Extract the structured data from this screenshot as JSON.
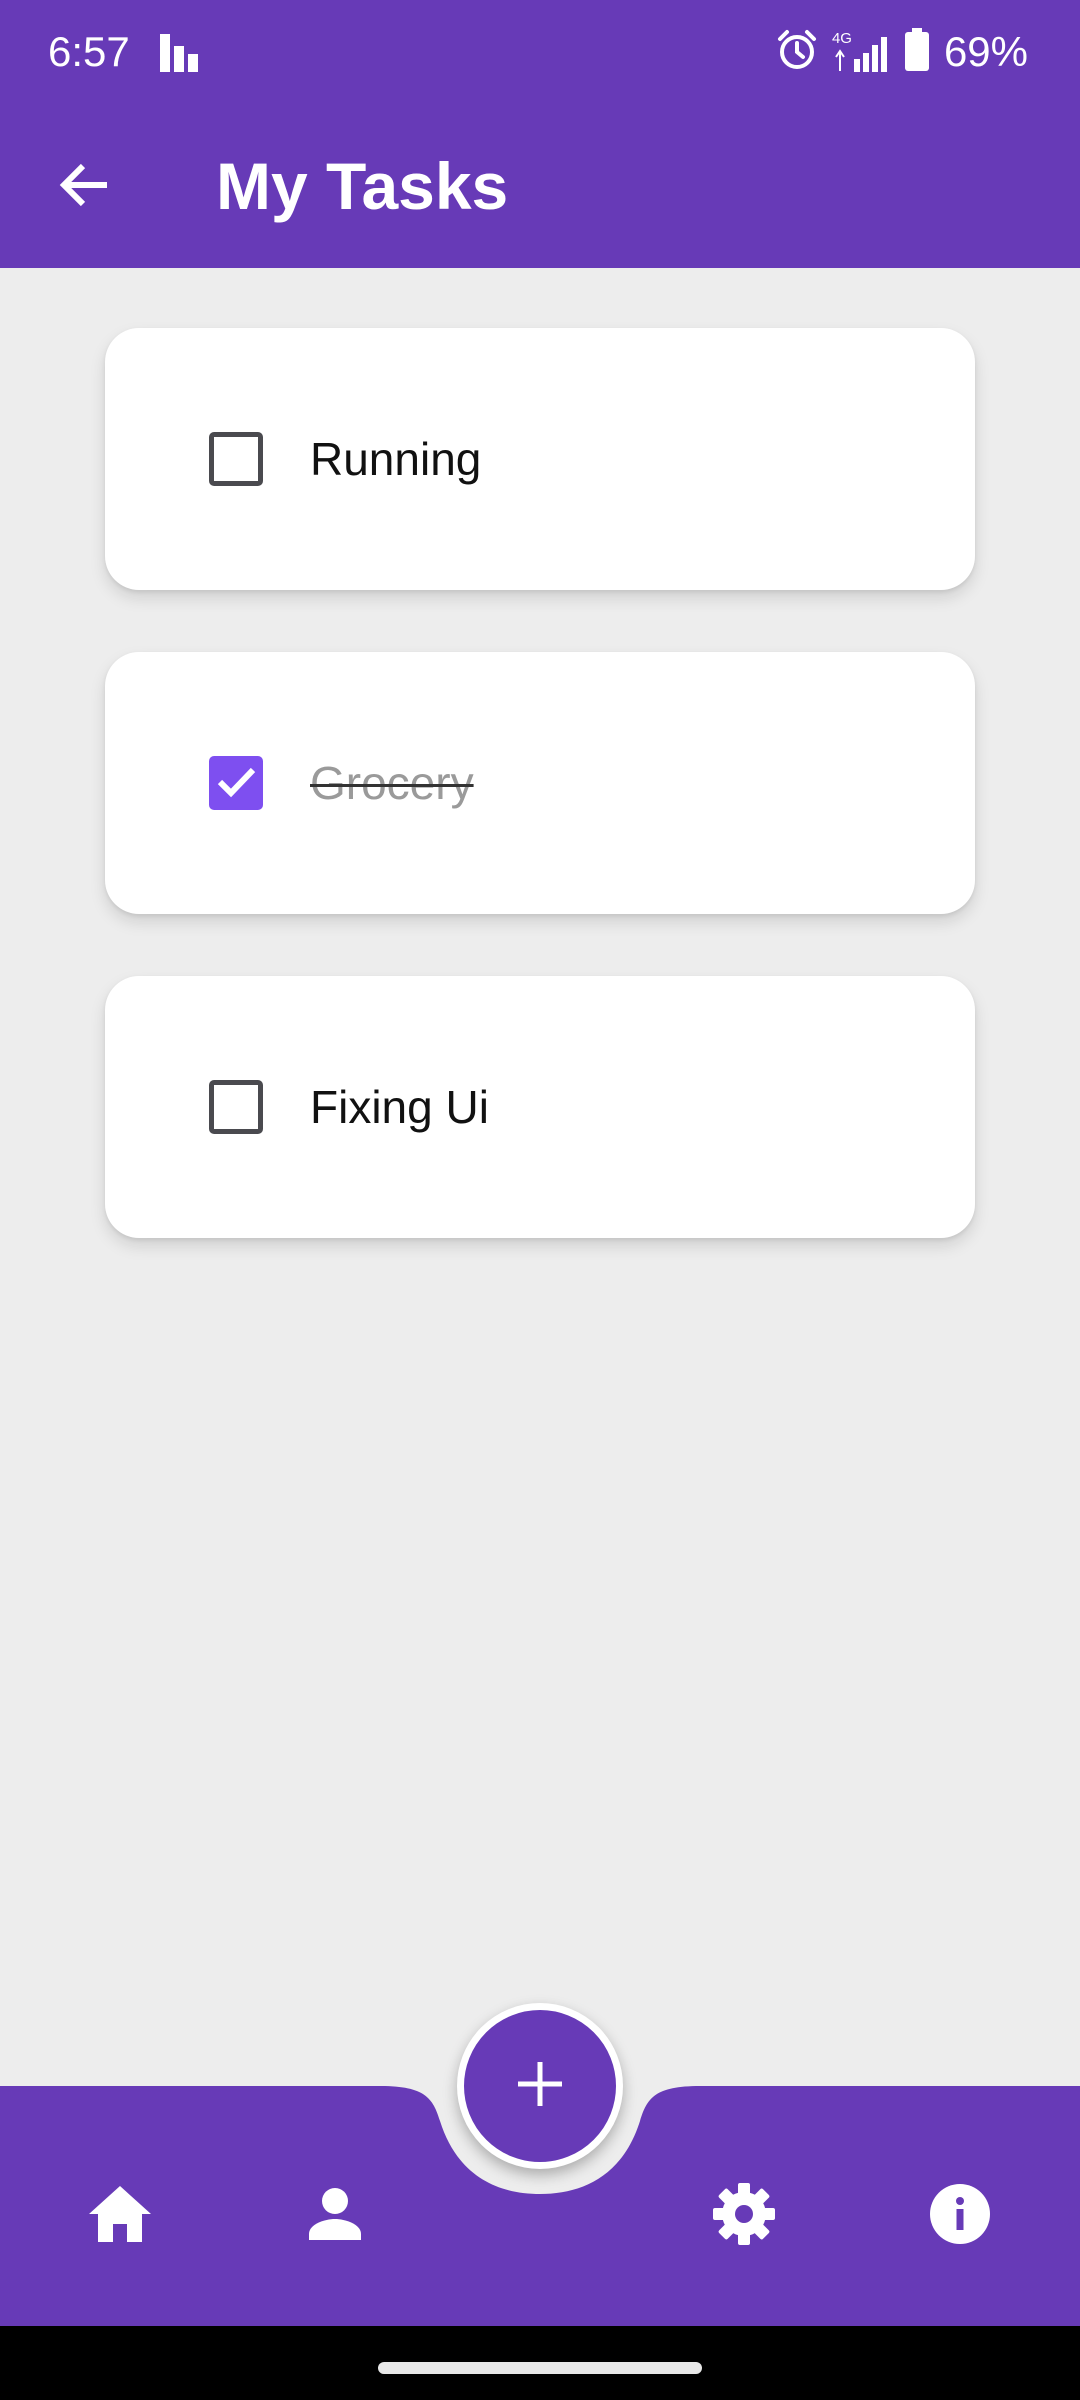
{
  "status_bar": {
    "time": "6:57",
    "network": "4G",
    "battery": "69%",
    "icons": [
      "activity-bars-icon",
      "alarm-icon",
      "signal-icon",
      "battery-icon"
    ]
  },
  "app_bar": {
    "title": "My Tasks",
    "back_icon": "arrow-left-icon"
  },
  "tasks": [
    {
      "label": "Running",
      "checked": false
    },
    {
      "label": "Grocery",
      "checked": true
    },
    {
      "label": "Fixing Ui",
      "checked": false
    }
  ],
  "bottom_nav": {
    "items": [
      "home-icon",
      "person-icon",
      "settings-gear-icon",
      "info-icon"
    ],
    "fab_icon": "plus-icon"
  },
  "colors": {
    "primary": "#673ab7",
    "checkbox_checked": "#7e4ff0",
    "background": "#ededed"
  }
}
